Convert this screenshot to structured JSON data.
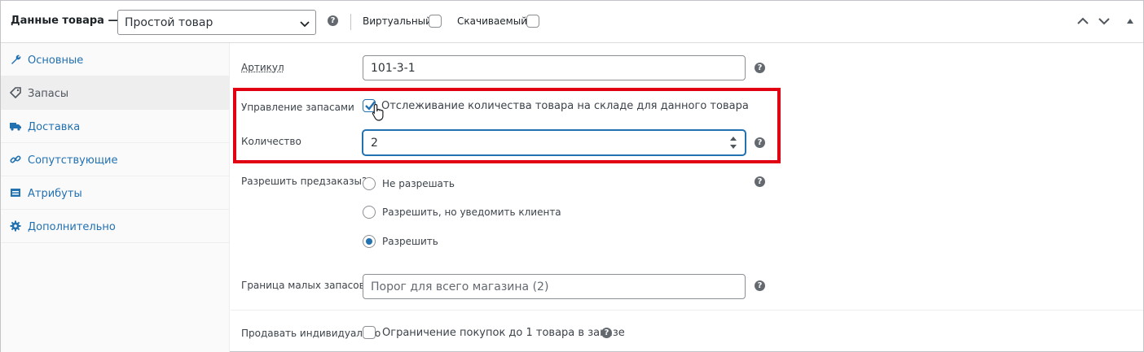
{
  "header": {
    "title": "Данные товара —",
    "product_type": "Простой товар",
    "virtual_label": "Виртуальный:",
    "downloadable_label": "Скачиваемый:",
    "help_icon": "?"
  },
  "tabs": [
    {
      "label": "Основные",
      "icon": "wrench-icon"
    },
    {
      "label": "Запасы",
      "icon": "tag-icon"
    },
    {
      "label": "Доставка",
      "icon": "truck-icon"
    },
    {
      "label": "Сопутствующие",
      "icon": "link-icon"
    },
    {
      "label": "Атрибуты",
      "icon": "list-icon"
    },
    {
      "label": "Дополнительно",
      "icon": "gear-icon"
    }
  ],
  "fields": {
    "sku_label": "Артикул",
    "sku_value": "101-3-1",
    "manage_stock_label": "Управление запасами",
    "manage_stock_text": "Отслеживание количества товара на складе для данного товара",
    "quantity_label": "Количество",
    "quantity_value": "2",
    "backorders_label": "Разрешить предзаказы?",
    "backorder_options": [
      "Не разрешать",
      "Разрешить, но уведомить клиента",
      "Разрешить"
    ],
    "backorder_selected": "Разрешить",
    "low_stock_label": "Граница малых запасов",
    "low_stock_placeholder": "Порог для всего магазина (2)",
    "sold_individually_label": "Продавать индивидуально",
    "sold_individually_text": "Ограничение покупок до 1 товара в заказе"
  },
  "colors": {
    "accent": "#2271b1",
    "highlight": "#e00012",
    "link": "#2271b1"
  }
}
